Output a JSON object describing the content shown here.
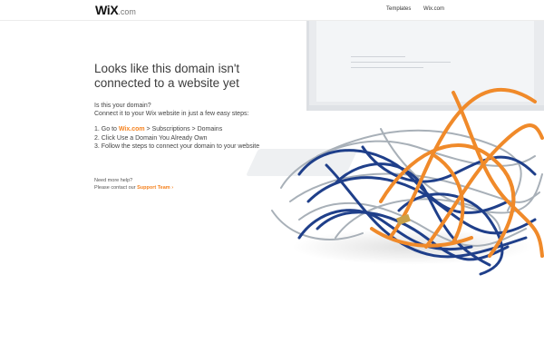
{
  "header": {
    "logo_main": "WiX",
    "logo_suffix": ".com",
    "nav": [
      {
        "label": "Templates"
      },
      {
        "label": "Wix.com"
      }
    ]
  },
  "main": {
    "headline_line1": "Looks like this domain isn't",
    "headline_line2": "connected to a website yet",
    "question": "Is this your domain?",
    "instructions": "Connect it to your Wix website in just a few easy steps:",
    "step1_prefix": "1. Go to ",
    "step1_link": "Wix.com",
    "step1_suffix": " > Subscriptions > Domains",
    "step2": "2. Click Use a Domain You Already Own",
    "step3": "3. Follow the steps to connect your domain to your website",
    "help_title": "Need more help?",
    "help_prefix": "Please contact our ",
    "help_link": "Support Team ›"
  },
  "colors": {
    "accent": "#f5821f",
    "cable_blue": "#1f3f8a",
    "cable_orange": "#f08a2a",
    "cable_gray": "#a8b0b8"
  },
  "image": {
    "subject": "tangled cables in front of a computer monitor"
  }
}
